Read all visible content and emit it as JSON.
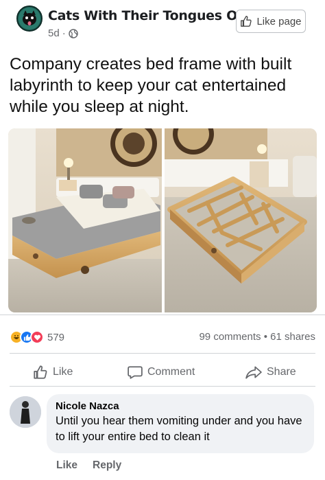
{
  "post": {
    "page_name": "Cats With Their Tongues Out",
    "time": "5d",
    "like_page_label": "Like page",
    "text": "Company creates bed frame with built labyrinth to keep your cat entertained while you sleep at night."
  },
  "engagement": {
    "reaction_count": "579",
    "comments": "99 comments",
    "separator": "•",
    "shares": "61 shares"
  },
  "actions": {
    "like": "Like",
    "comment": "Comment",
    "share": "Share"
  },
  "comment": {
    "author": "Nicole Nazca",
    "text": "Until you hear them vomiting under and you have to lift your entire bed to clean it",
    "like_label": "Like",
    "reply_label": "Reply"
  },
  "icons": {
    "reactions": [
      "haha-icon",
      "like-icon",
      "love-icon"
    ],
    "privacy": "globe-icon"
  },
  "colors": {
    "like_blue": "#1877f2",
    "love_red": "#f33e58",
    "haha_yellow": "#f7b125",
    "muted_text": "#65676b"
  }
}
